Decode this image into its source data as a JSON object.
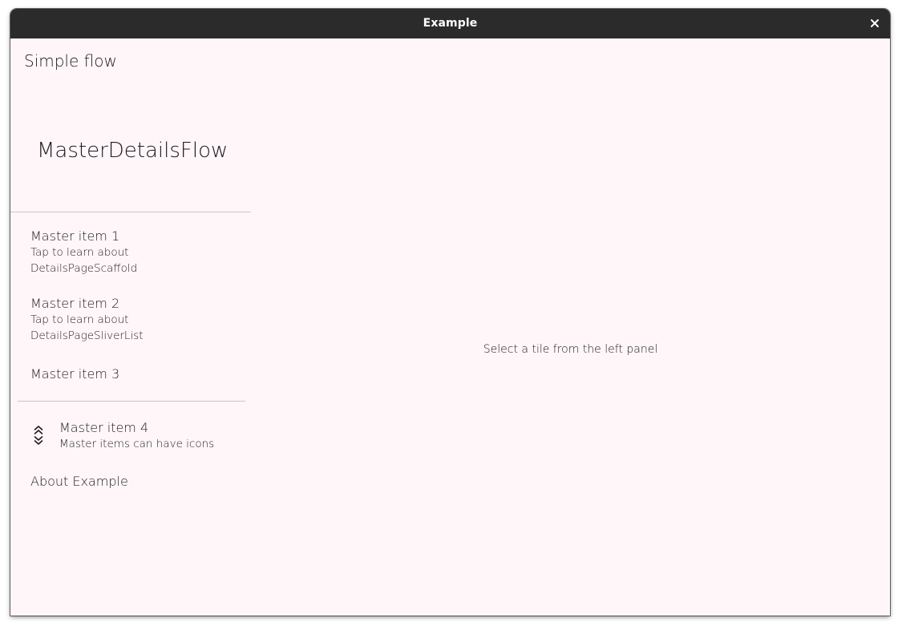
{
  "window": {
    "title": "Example",
    "close_icon": "close-icon"
  },
  "app_bar": {
    "title": "Simple flow"
  },
  "master": {
    "header": "MasterDetailsFlow",
    "items": [
      {
        "title": "Master item 1",
        "subtitle_line1": "Tap to learn about",
        "subtitle_line2": "DetailsPageScaffold"
      },
      {
        "title": "Master item 2",
        "subtitle_line1": "Tap to learn about",
        "subtitle_line2": "DetailsPageSliverList"
      },
      {
        "title": "Master item 3"
      },
      {
        "title": "Master item 4",
        "subtitle_line1": "Master items can have icons",
        "icon": "double-chevron-expand-icon"
      },
      {
        "title": "About Example"
      }
    ]
  },
  "details": {
    "placeholder": "Select a tile from the left panel"
  },
  "colors": {
    "titlebar": "#2b2b2b",
    "background": "#fff6f9",
    "divider": "#cac4d0",
    "text": "#1d1b20"
  }
}
